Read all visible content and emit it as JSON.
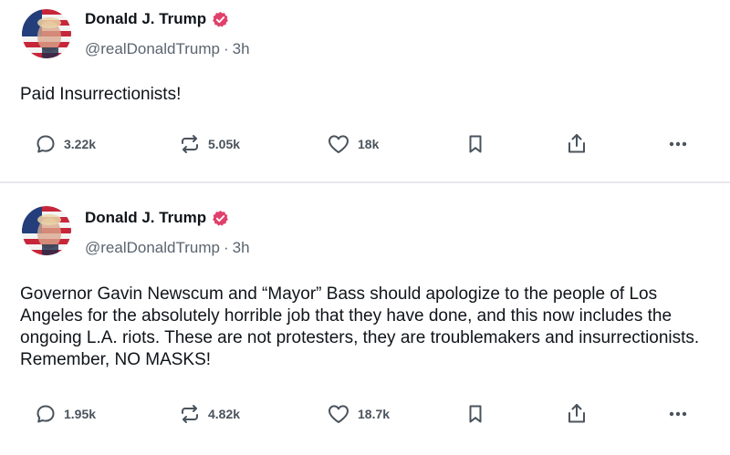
{
  "posts": [
    {
      "author": {
        "name": "Donald J. Trump",
        "handle": "@realDonaldTrump",
        "time": "3h",
        "separator": "·"
      },
      "text": "Paid Insurrectionists!",
      "stats": {
        "replies": "3.22k",
        "retruths": "5.05k",
        "likes": "18k"
      }
    },
    {
      "author": {
        "name": "Donald J. Trump",
        "handle": "@realDonaldTrump",
        "time": "3h",
        "separator": "·"
      },
      "text": "Governor Gavin Newscum and “Mayor” Bass should apologize to the people of Los Angeles for the absolutely horrible job that they have done, and this now includes the ongoing L.A. riots. These are not protesters, they are troublemakers and insurrectionists. Remember, NO MASKS!",
      "stats": {
        "replies": "1.95k",
        "retruths": "4.82k",
        "likes": "18.7k"
      }
    }
  ],
  "icons": {
    "verified": "verified-badge-icon",
    "reply": "comment-bubble-icon",
    "retruth": "repost-arrows-icon",
    "like": "heart-icon",
    "save": "bookmark-icon",
    "share": "share-upload-icon",
    "more": "more-dots-icon"
  },
  "colors": {
    "verified": "#e0406a",
    "icon": "#4a535c",
    "text": "#0f1419",
    "muted": "#5b6570",
    "divider": "#e6e6ea"
  }
}
